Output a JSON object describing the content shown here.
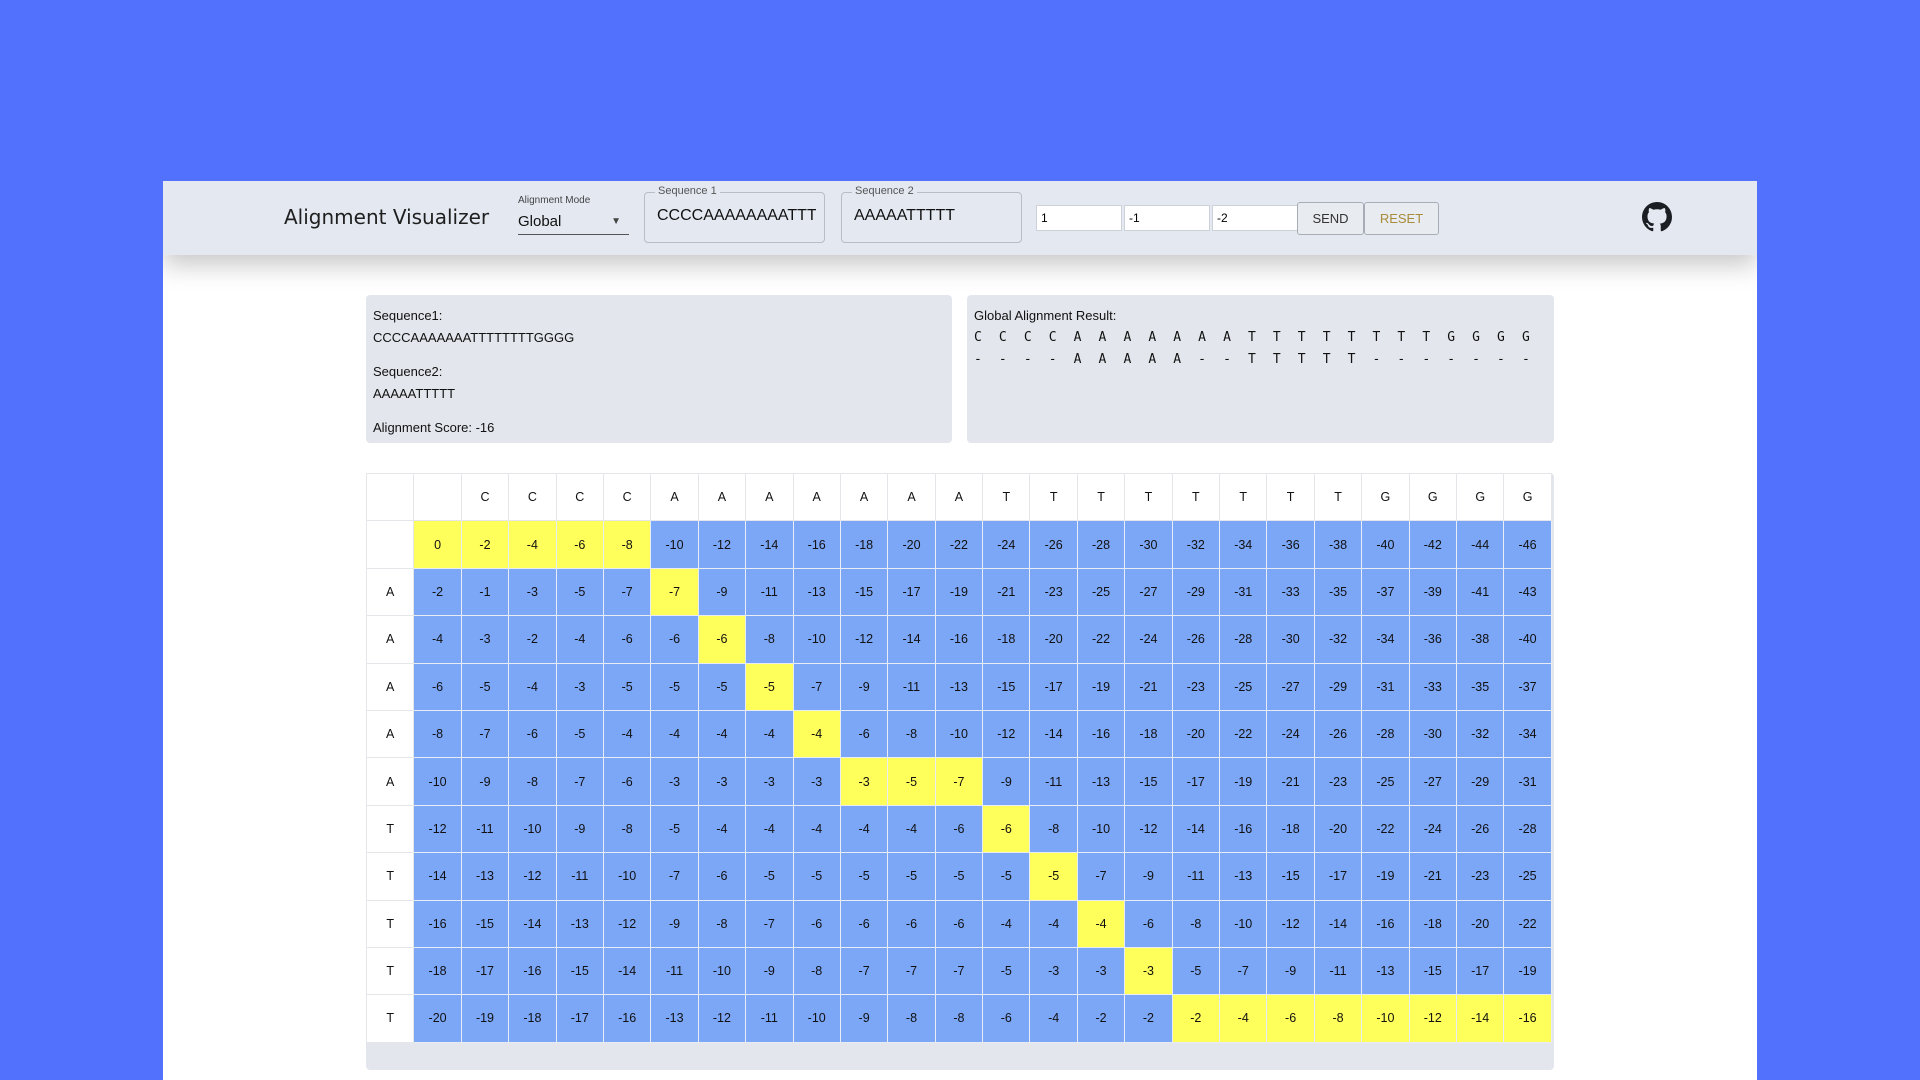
{
  "toolbar": {
    "title": "Alignment Visualizer",
    "mode_label": "Alignment Mode",
    "mode_value": "Global",
    "seq1_label": "Sequence 1",
    "seq1_value": "CCCCAAAAAAAATTTTTTTTGGGG",
    "seq2_label": "Sequence 2",
    "seq2_value": "AAAAATTTTT",
    "match_value": "1",
    "mismatch_value": "-1",
    "gap_value": "-2",
    "send_label": "SEND",
    "reset_label": "RESET"
  },
  "info": {
    "seq1_heading": "Sequence1:",
    "seq1": "CCCCAAAAAAATTTTTTTTGGGG",
    "seq2_heading": "Sequence2:",
    "seq2": "AAAAATTTTT",
    "score_text": "Alignment Score: -16"
  },
  "result": {
    "heading": "Global Alignment Result:",
    "top": [
      "C",
      "C",
      "C",
      "C",
      "A",
      "A",
      "A",
      "A",
      "A",
      "A",
      "A",
      "T",
      "T",
      "T",
      "T",
      "T",
      "T",
      "T",
      "T",
      "G",
      "G",
      "G",
      "G"
    ],
    "bottom": [
      "-",
      "-",
      "-",
      "-",
      "A",
      "A",
      "A",
      "A",
      "A",
      "-",
      "-",
      "T",
      "T",
      "T",
      "T",
      "T",
      "-",
      "-",
      "-",
      "-",
      "-",
      "-",
      "-"
    ]
  },
  "matrix": {
    "col_headers": [
      "C",
      "C",
      "C",
      "C",
      "A",
      "A",
      "A",
      "A",
      "A",
      "A",
      "A",
      "T",
      "T",
      "T",
      "T",
      "T",
      "T",
      "T",
      "T",
      "G",
      "G",
      "G",
      "G"
    ],
    "row_headers": [
      "",
      "A",
      "A",
      "A",
      "A",
      "A",
      "T",
      "T",
      "T",
      "T",
      "T"
    ],
    "rows": [
      [
        0,
        -2,
        -4,
        -6,
        -8,
        -10,
        -12,
        -14,
        -16,
        -18,
        -20,
        -22,
        -24,
        -26,
        -28,
        -30,
        -32,
        -34,
        -36,
        -38,
        -40,
        -42,
        -44,
        -46
      ],
      [
        -2,
        -1,
        -3,
        -5,
        -7,
        -7,
        -9,
        -11,
        -13,
        -15,
        -17,
        -19,
        -21,
        -23,
        -25,
        -27,
        -29,
        -31,
        -33,
        -35,
        -37,
        -39,
        -41,
        -43
      ],
      [
        -4,
        -3,
        -2,
        -4,
        -6,
        -6,
        -6,
        -8,
        -10,
        -12,
        -14,
        -16,
        -18,
        -20,
        -22,
        -24,
        -26,
        -28,
        -30,
        -32,
        -34,
        -36,
        -38,
        -40
      ],
      [
        -6,
        -5,
        -4,
        -3,
        -5,
        -5,
        -5,
        -5,
        -7,
        -9,
        -11,
        -13,
        -15,
        -17,
        -19,
        -21,
        -23,
        -25,
        -27,
        -29,
        -31,
        -33,
        -35,
        -37
      ],
      [
        -8,
        -7,
        -6,
        -5,
        -4,
        -4,
        -4,
        -4,
        -4,
        -6,
        -8,
        -10,
        -12,
        -14,
        -16,
        -18,
        -20,
        -22,
        -24,
        -26,
        -28,
        -30,
        -32,
        -34
      ],
      [
        -10,
        -9,
        -8,
        -7,
        -6,
        -3,
        -3,
        -3,
        -3,
        -3,
        -5,
        -7,
        -9,
        -11,
        -13,
        -15,
        -17,
        -19,
        -21,
        -23,
        -25,
        -27,
        -29,
        -31
      ],
      [
        -12,
        -11,
        -10,
        -9,
        -8,
        -5,
        -4,
        -4,
        -4,
        -4,
        -4,
        -6,
        -6,
        -8,
        -10,
        -12,
        -14,
        -16,
        -18,
        -20,
        -22,
        -24,
        -26,
        -28
      ],
      [
        -14,
        -13,
        -12,
        -11,
        -10,
        -7,
        -6,
        -5,
        -5,
        -5,
        -5,
        -5,
        -5,
        -5,
        -7,
        -9,
        -11,
        -13,
        -15,
        -17,
        -19,
        -21,
        -23,
        -25
      ],
      [
        -16,
        -15,
        -14,
        -13,
        -12,
        -9,
        -8,
        -7,
        -6,
        -6,
        -6,
        -6,
        -4,
        -4,
        -4,
        -6,
        -8,
        -10,
        -12,
        -14,
        -16,
        -18,
        -20,
        -22
      ],
      [
        -18,
        -17,
        -16,
        -15,
        -14,
        -11,
        -10,
        -9,
        -8,
        -7,
        -7,
        -7,
        -5,
        -3,
        -3,
        -3,
        -5,
        -7,
        -9,
        -11,
        -13,
        -15,
        -17,
        -19
      ],
      [
        -20,
        -19,
        -18,
        -17,
        -16,
        -13,
        -12,
        -11,
        -10,
        -9,
        -8,
        -8,
        -6,
        -4,
        -2,
        -2,
        -2,
        -4,
        -6,
        -8,
        -10,
        -12,
        -14,
        -16
      ]
    ],
    "path": [
      [
        0,
        0
      ],
      [
        0,
        1
      ],
      [
        0,
        2
      ],
      [
        0,
        3
      ],
      [
        0,
        4
      ],
      [
        1,
        5
      ],
      [
        2,
        6
      ],
      [
        3,
        7
      ],
      [
        4,
        8
      ],
      [
        5,
        9
      ],
      [
        5,
        10
      ],
      [
        5,
        11
      ],
      [
        6,
        12
      ],
      [
        7,
        13
      ],
      [
        8,
        14
      ],
      [
        9,
        15
      ],
      [
        10,
        16
      ],
      [
        10,
        17
      ],
      [
        10,
        18
      ],
      [
        10,
        19
      ],
      [
        10,
        20
      ],
      [
        10,
        21
      ],
      [
        10,
        22
      ],
      [
        10,
        23
      ]
    ],
    "path_color": "#ffff5c",
    "cell_color": "#7ca6f6"
  }
}
